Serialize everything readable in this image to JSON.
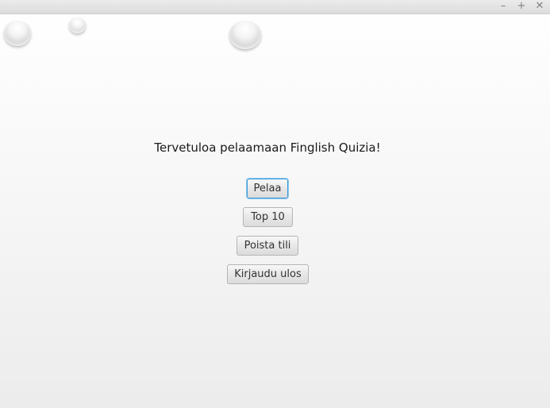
{
  "window": {
    "controls": {
      "minimize": "–",
      "maximize": "+",
      "close": "✕"
    },
    "decorations": [
      "water-drop",
      "water-drop",
      "water-drop"
    ]
  },
  "main": {
    "welcome_text": "Tervetuloa pelaamaan Finglish Quizia!",
    "buttons": {
      "play": "Pelaa",
      "top10": "Top 10",
      "delete_account": "Poista tili",
      "logout": "Kirjaudu ulos"
    },
    "focused_button": "play",
    "accent_color": "#3a9ad9"
  }
}
